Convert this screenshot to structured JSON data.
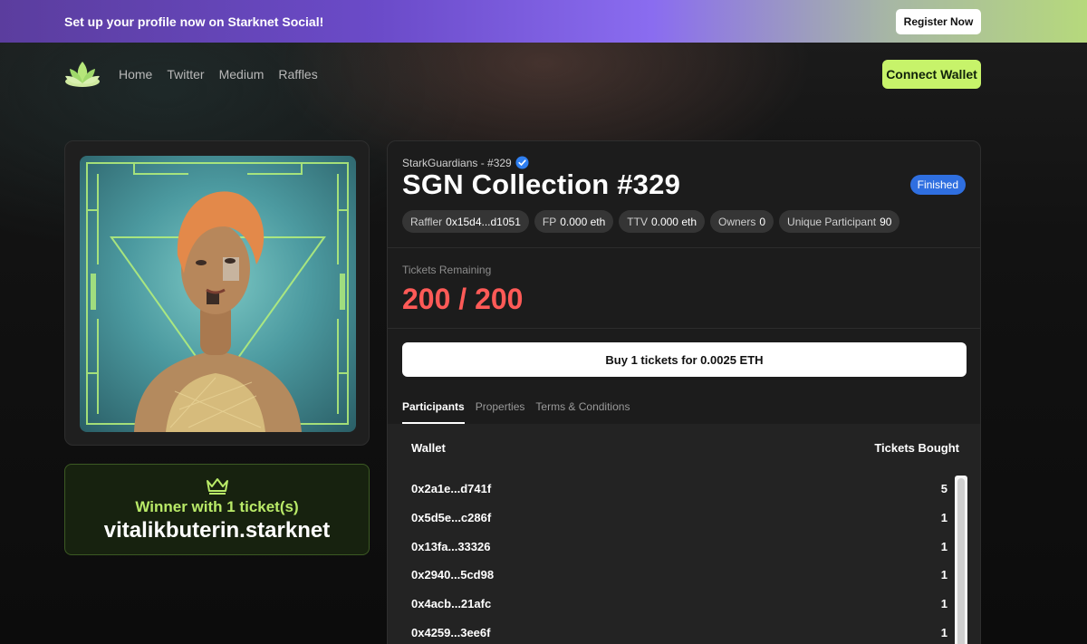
{
  "banner": {
    "text": "Set up your profile now on Starknet Social!",
    "register_label": "Register Now"
  },
  "nav": {
    "logo_icon": "lotus-logo-icon",
    "links": [
      "Home",
      "Twitter",
      "Medium",
      "Raffles"
    ],
    "connect_label": "Connect Wallet"
  },
  "winner": {
    "crown_icon": "crown-icon",
    "label": "Winner with 1 ticket(s)",
    "name": "vitalikbuterin.starknet"
  },
  "raffle": {
    "collection": "StarkGuardians - #329",
    "verified_icon": "verified-check-icon",
    "title": "SGN Collection #329",
    "status": "Finished",
    "chips": [
      {
        "label": "Raffler",
        "value": "0x15d4...d1051"
      },
      {
        "label": "FP",
        "value": "0.000 eth"
      },
      {
        "label": "TTV",
        "value": "0.000 eth"
      },
      {
        "label": "Owners",
        "value": "0"
      },
      {
        "label": "Unique Participant",
        "value": "90"
      }
    ],
    "tickets_label": "Tickets Remaining",
    "tickets_value": "200 / 200",
    "buy_label": "Buy 1 tickets for 0.0025 ETH"
  },
  "tabs": [
    "Participants",
    "Properties",
    "Terms & Conditions"
  ],
  "participants": {
    "col_wallet": "Wallet",
    "col_tickets": "Tickets Bought",
    "rows": [
      {
        "wallet": "0x2a1e...d741f",
        "tickets": "5"
      },
      {
        "wallet": "0x5d5e...c286f",
        "tickets": "1"
      },
      {
        "wallet": "0x13fa...33326",
        "tickets": "1"
      },
      {
        "wallet": "0x2940...5cd98",
        "tickets": "1"
      },
      {
        "wallet": "0x4acb...21afc",
        "tickets": "1"
      },
      {
        "wallet": "0x4259...3ee6f",
        "tickets": "1"
      }
    ]
  },
  "colors": {
    "accent_green": "#c7f36a",
    "winner_green": "#b9ea68",
    "tickets_red": "#ff5a57",
    "status_blue": "#2f6fe0"
  }
}
